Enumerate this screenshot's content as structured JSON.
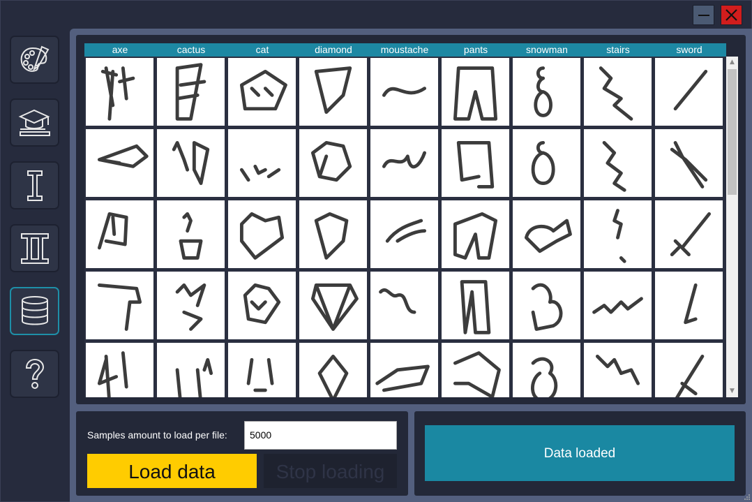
{
  "window": {
    "minimize_icon": "minimize-icon",
    "close_icon": "close-icon",
    "close_color": "#d11d1d"
  },
  "sidebar": {
    "items": [
      {
        "name": "paint",
        "icon": "palette-icon"
      },
      {
        "name": "train",
        "icon": "graduation-cap-icon"
      },
      {
        "name": "model-1",
        "icon": "roman-one-icon"
      },
      {
        "name": "model-2",
        "icon": "roman-two-icon"
      },
      {
        "name": "data",
        "icon": "database-icon",
        "active": true
      },
      {
        "name": "help",
        "icon": "question-mark-icon"
      }
    ],
    "accent": "#1e8fa8"
  },
  "gallery": {
    "columns": [
      "axe",
      "cactus",
      "cat",
      "diamond",
      "moustache",
      "pants",
      "snowman",
      "stairs",
      "sword"
    ],
    "rows_visible": 5,
    "header_color": "#1d88a3"
  },
  "loader": {
    "samples_label": "Samples amount to load per file:",
    "samples_value": "5000",
    "load_button": "Load data",
    "stop_button": "Stop loading",
    "load_color": "#ffcc00"
  },
  "status": {
    "text": "Data loaded",
    "color": "#1a88a2"
  }
}
